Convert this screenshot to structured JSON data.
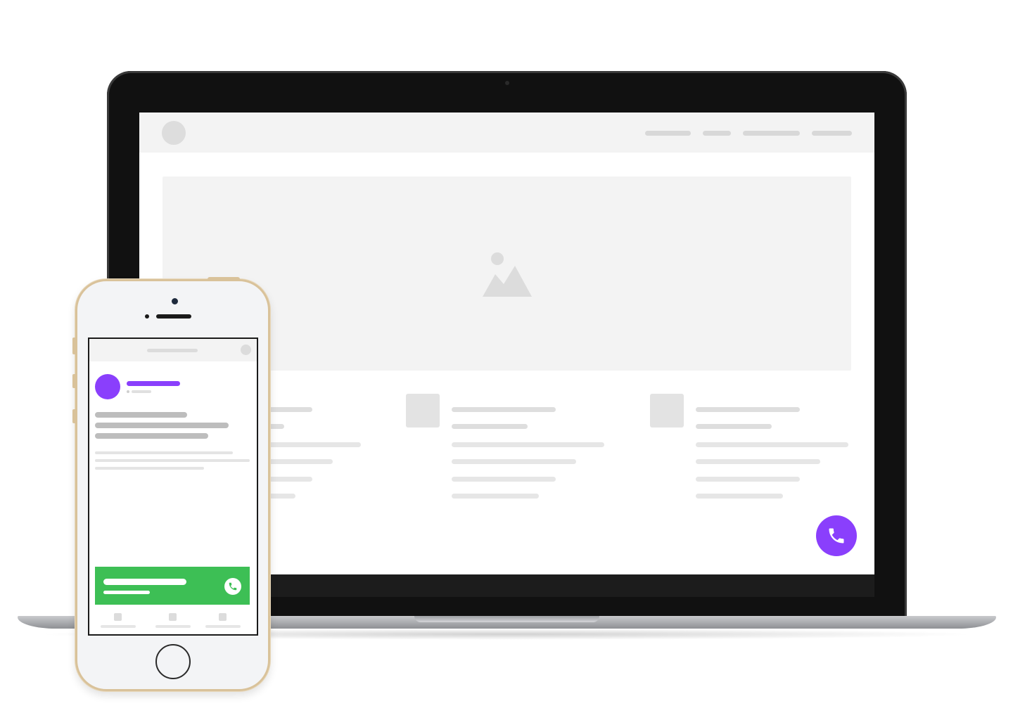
{
  "illustration": {
    "description_type": "device-mockup",
    "devices": [
      "laptop",
      "smartphone"
    ]
  },
  "colors": {
    "accent_purple": "#8a3ffc",
    "call_green": "#3dbf55",
    "placeholder_gray": "#f3f3f3",
    "skeleton_line": "#dedede",
    "phone_frame_gold": "#d9c29a",
    "laptop_bezel": "#111111"
  },
  "laptop": {
    "page": {
      "header": {
        "logo_icon": "circle-logo-placeholder",
        "nav_items_count": 4
      },
      "hero": {
        "icon": "image-placeholder-icon"
      },
      "features": {
        "count": 3,
        "icon": "square-placeholder"
      },
      "floating_button": {
        "icon": "phone-icon",
        "color": "#8a3ffc"
      }
    }
  },
  "phone": {
    "page": {
      "chat_header": {
        "avatar_color": "#8a3ffc",
        "name_color": "#8a3ffc"
      },
      "call_button": {
        "icon": "phone-icon",
        "color": "#3dbf55"
      },
      "tab_bar": {
        "tabs_count": 3
      }
    }
  }
}
